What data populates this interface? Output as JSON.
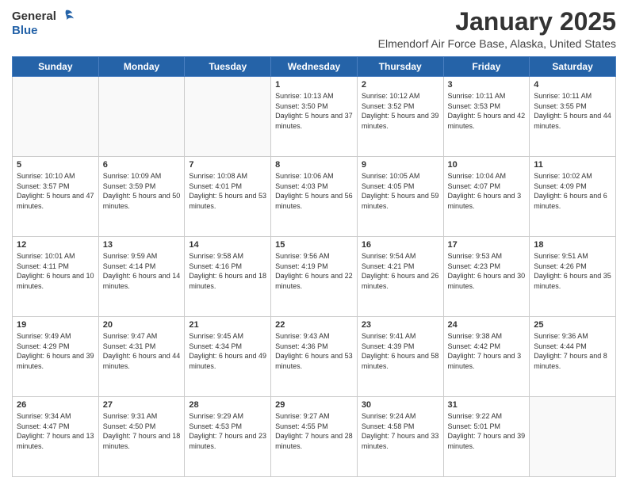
{
  "logo": {
    "general": "General",
    "blue": "Blue"
  },
  "title": "January 2025",
  "subtitle": "Elmendorf Air Force Base, Alaska, United States",
  "weekdays": [
    "Sunday",
    "Monday",
    "Tuesday",
    "Wednesday",
    "Thursday",
    "Friday",
    "Saturday"
  ],
  "weeks": [
    [
      {
        "day": "",
        "info": ""
      },
      {
        "day": "",
        "info": ""
      },
      {
        "day": "",
        "info": ""
      },
      {
        "day": "1",
        "info": "Sunrise: 10:13 AM\nSunset: 3:50 PM\nDaylight: 5 hours and 37 minutes."
      },
      {
        "day": "2",
        "info": "Sunrise: 10:12 AM\nSunset: 3:52 PM\nDaylight: 5 hours and 39 minutes."
      },
      {
        "day": "3",
        "info": "Sunrise: 10:11 AM\nSunset: 3:53 PM\nDaylight: 5 hours and 42 minutes."
      },
      {
        "day": "4",
        "info": "Sunrise: 10:11 AM\nSunset: 3:55 PM\nDaylight: 5 hours and 44 minutes."
      }
    ],
    [
      {
        "day": "5",
        "info": "Sunrise: 10:10 AM\nSunset: 3:57 PM\nDaylight: 5 hours and 47 minutes."
      },
      {
        "day": "6",
        "info": "Sunrise: 10:09 AM\nSunset: 3:59 PM\nDaylight: 5 hours and 50 minutes."
      },
      {
        "day": "7",
        "info": "Sunrise: 10:08 AM\nSunset: 4:01 PM\nDaylight: 5 hours and 53 minutes."
      },
      {
        "day": "8",
        "info": "Sunrise: 10:06 AM\nSunset: 4:03 PM\nDaylight: 5 hours and 56 minutes."
      },
      {
        "day": "9",
        "info": "Sunrise: 10:05 AM\nSunset: 4:05 PM\nDaylight: 5 hours and 59 minutes."
      },
      {
        "day": "10",
        "info": "Sunrise: 10:04 AM\nSunset: 4:07 PM\nDaylight: 6 hours and 3 minutes."
      },
      {
        "day": "11",
        "info": "Sunrise: 10:02 AM\nSunset: 4:09 PM\nDaylight: 6 hours and 6 minutes."
      }
    ],
    [
      {
        "day": "12",
        "info": "Sunrise: 10:01 AM\nSunset: 4:11 PM\nDaylight: 6 hours and 10 minutes."
      },
      {
        "day": "13",
        "info": "Sunrise: 9:59 AM\nSunset: 4:14 PM\nDaylight: 6 hours and 14 minutes."
      },
      {
        "day": "14",
        "info": "Sunrise: 9:58 AM\nSunset: 4:16 PM\nDaylight: 6 hours and 18 minutes."
      },
      {
        "day": "15",
        "info": "Sunrise: 9:56 AM\nSunset: 4:19 PM\nDaylight: 6 hours and 22 minutes."
      },
      {
        "day": "16",
        "info": "Sunrise: 9:54 AM\nSunset: 4:21 PM\nDaylight: 6 hours and 26 minutes."
      },
      {
        "day": "17",
        "info": "Sunrise: 9:53 AM\nSunset: 4:23 PM\nDaylight: 6 hours and 30 minutes."
      },
      {
        "day": "18",
        "info": "Sunrise: 9:51 AM\nSunset: 4:26 PM\nDaylight: 6 hours and 35 minutes."
      }
    ],
    [
      {
        "day": "19",
        "info": "Sunrise: 9:49 AM\nSunset: 4:29 PM\nDaylight: 6 hours and 39 minutes."
      },
      {
        "day": "20",
        "info": "Sunrise: 9:47 AM\nSunset: 4:31 PM\nDaylight: 6 hours and 44 minutes."
      },
      {
        "day": "21",
        "info": "Sunrise: 9:45 AM\nSunset: 4:34 PM\nDaylight: 6 hours and 49 minutes."
      },
      {
        "day": "22",
        "info": "Sunrise: 9:43 AM\nSunset: 4:36 PM\nDaylight: 6 hours and 53 minutes."
      },
      {
        "day": "23",
        "info": "Sunrise: 9:41 AM\nSunset: 4:39 PM\nDaylight: 6 hours and 58 minutes."
      },
      {
        "day": "24",
        "info": "Sunrise: 9:38 AM\nSunset: 4:42 PM\nDaylight: 7 hours and 3 minutes."
      },
      {
        "day": "25",
        "info": "Sunrise: 9:36 AM\nSunset: 4:44 PM\nDaylight: 7 hours and 8 minutes."
      }
    ],
    [
      {
        "day": "26",
        "info": "Sunrise: 9:34 AM\nSunset: 4:47 PM\nDaylight: 7 hours and 13 minutes."
      },
      {
        "day": "27",
        "info": "Sunrise: 9:31 AM\nSunset: 4:50 PM\nDaylight: 7 hours and 18 minutes."
      },
      {
        "day": "28",
        "info": "Sunrise: 9:29 AM\nSunset: 4:53 PM\nDaylight: 7 hours and 23 minutes."
      },
      {
        "day": "29",
        "info": "Sunrise: 9:27 AM\nSunset: 4:55 PM\nDaylight: 7 hours and 28 minutes."
      },
      {
        "day": "30",
        "info": "Sunrise: 9:24 AM\nSunset: 4:58 PM\nDaylight: 7 hours and 33 minutes."
      },
      {
        "day": "31",
        "info": "Sunrise: 9:22 AM\nSunset: 5:01 PM\nDaylight: 7 hours and 39 minutes."
      },
      {
        "day": "",
        "info": ""
      }
    ]
  ]
}
